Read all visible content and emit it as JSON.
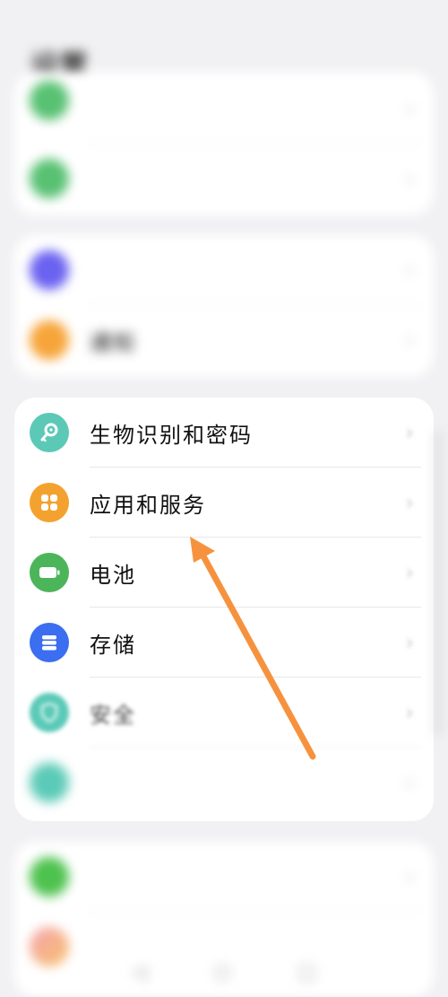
{
  "status_bar": {
    "left": "",
    "right": ""
  },
  "page_title": "设置",
  "card1": {
    "items": [
      {
        "label": "",
        "icon": "green-circle-icon",
        "color": "#58c172"
      },
      {
        "label": "",
        "icon": "display-icon",
        "color": "#58c172"
      }
    ]
  },
  "card2": {
    "items": [
      {
        "label": "",
        "icon": "sound-icon",
        "color": "#6a62f0"
      },
      {
        "label": "通知",
        "icon": "notification-icon",
        "color": "#f7a53a"
      }
    ]
  },
  "card3": {
    "items": [
      {
        "label": "生物识别和密码",
        "icon": "key-icon",
        "color": "#5cc9b6"
      },
      {
        "label": "应用和服务",
        "icon": "apps-icon",
        "color": "#f4a22f"
      },
      {
        "label": "电池",
        "icon": "battery-icon",
        "color": "#4cb55a"
      },
      {
        "label": "存储",
        "icon": "storage-icon",
        "color": "#3b6ef0"
      },
      {
        "label": "安全",
        "icon": "shield-icon",
        "color": "#5ccab8"
      },
      {
        "label": "",
        "icon": "privacy-icon",
        "color": "#5ccab8"
      }
    ]
  },
  "card4": {
    "items": [
      {
        "label": "",
        "icon": "green-circle-icon",
        "color": "#4ec24e"
      },
      {
        "label": "",
        "icon": "gradient-icon",
        "color": "#f0a0a0"
      }
    ]
  },
  "chevron": "›",
  "colors": {
    "background": "#f1f1f3",
    "card": "#ffffff",
    "arrow": "#f6923e"
  }
}
